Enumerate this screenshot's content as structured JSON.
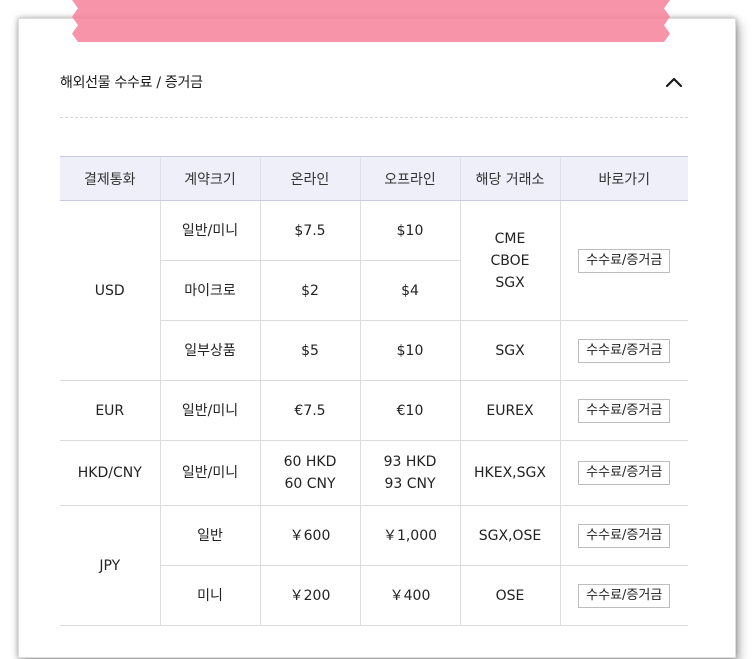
{
  "section": {
    "title": "해외선물 수수료 / 증거금",
    "toggle_icon": "chevron-up-icon"
  },
  "table": {
    "headers": [
      "결제통화",
      "계약크기",
      "온라인",
      "오프라인",
      "해당 거래소",
      "바로가기"
    ],
    "button_label": "수수료/증거금",
    "groups": {
      "usd": {
        "currency": "USD",
        "rows": [
          {
            "size": "일반/미니",
            "online": "$7.5",
            "offline": "$10"
          },
          {
            "size": "마이크로",
            "online": "$2",
            "offline": "$4"
          },
          {
            "size": "일부상품",
            "online": "$5",
            "offline": "$10",
            "exchange": "SGX"
          }
        ],
        "exchange_lines": [
          "CME",
          "CBOE",
          "SGX"
        ]
      },
      "eur": {
        "currency": "EUR",
        "rows": [
          {
            "size": "일반/미니",
            "online": "€7.5",
            "offline": "€10",
            "exchange": "EUREX"
          }
        ]
      },
      "hkd": {
        "currency": "HKD/CNY",
        "rows": [
          {
            "size": "일반/미니",
            "online_lines": [
              "60 HKD",
              "60 CNY"
            ],
            "offline_lines": [
              "93 HKD",
              "93 CNY"
            ],
            "exchange": "HKEX,SGX"
          }
        ]
      },
      "jpy": {
        "currency": "JPY",
        "rows": [
          {
            "size": "일반",
            "online": "￥600",
            "offline": "￥1,000",
            "exchange": "SGX,OSE"
          },
          {
            "size": "미니",
            "online": "￥200",
            "offline": "￥400",
            "exchange": "OSE"
          }
        ]
      }
    }
  },
  "colors": {
    "header_bg": "#eeeff9",
    "tape": "#f7819b",
    "border": "#dcdcdc"
  }
}
